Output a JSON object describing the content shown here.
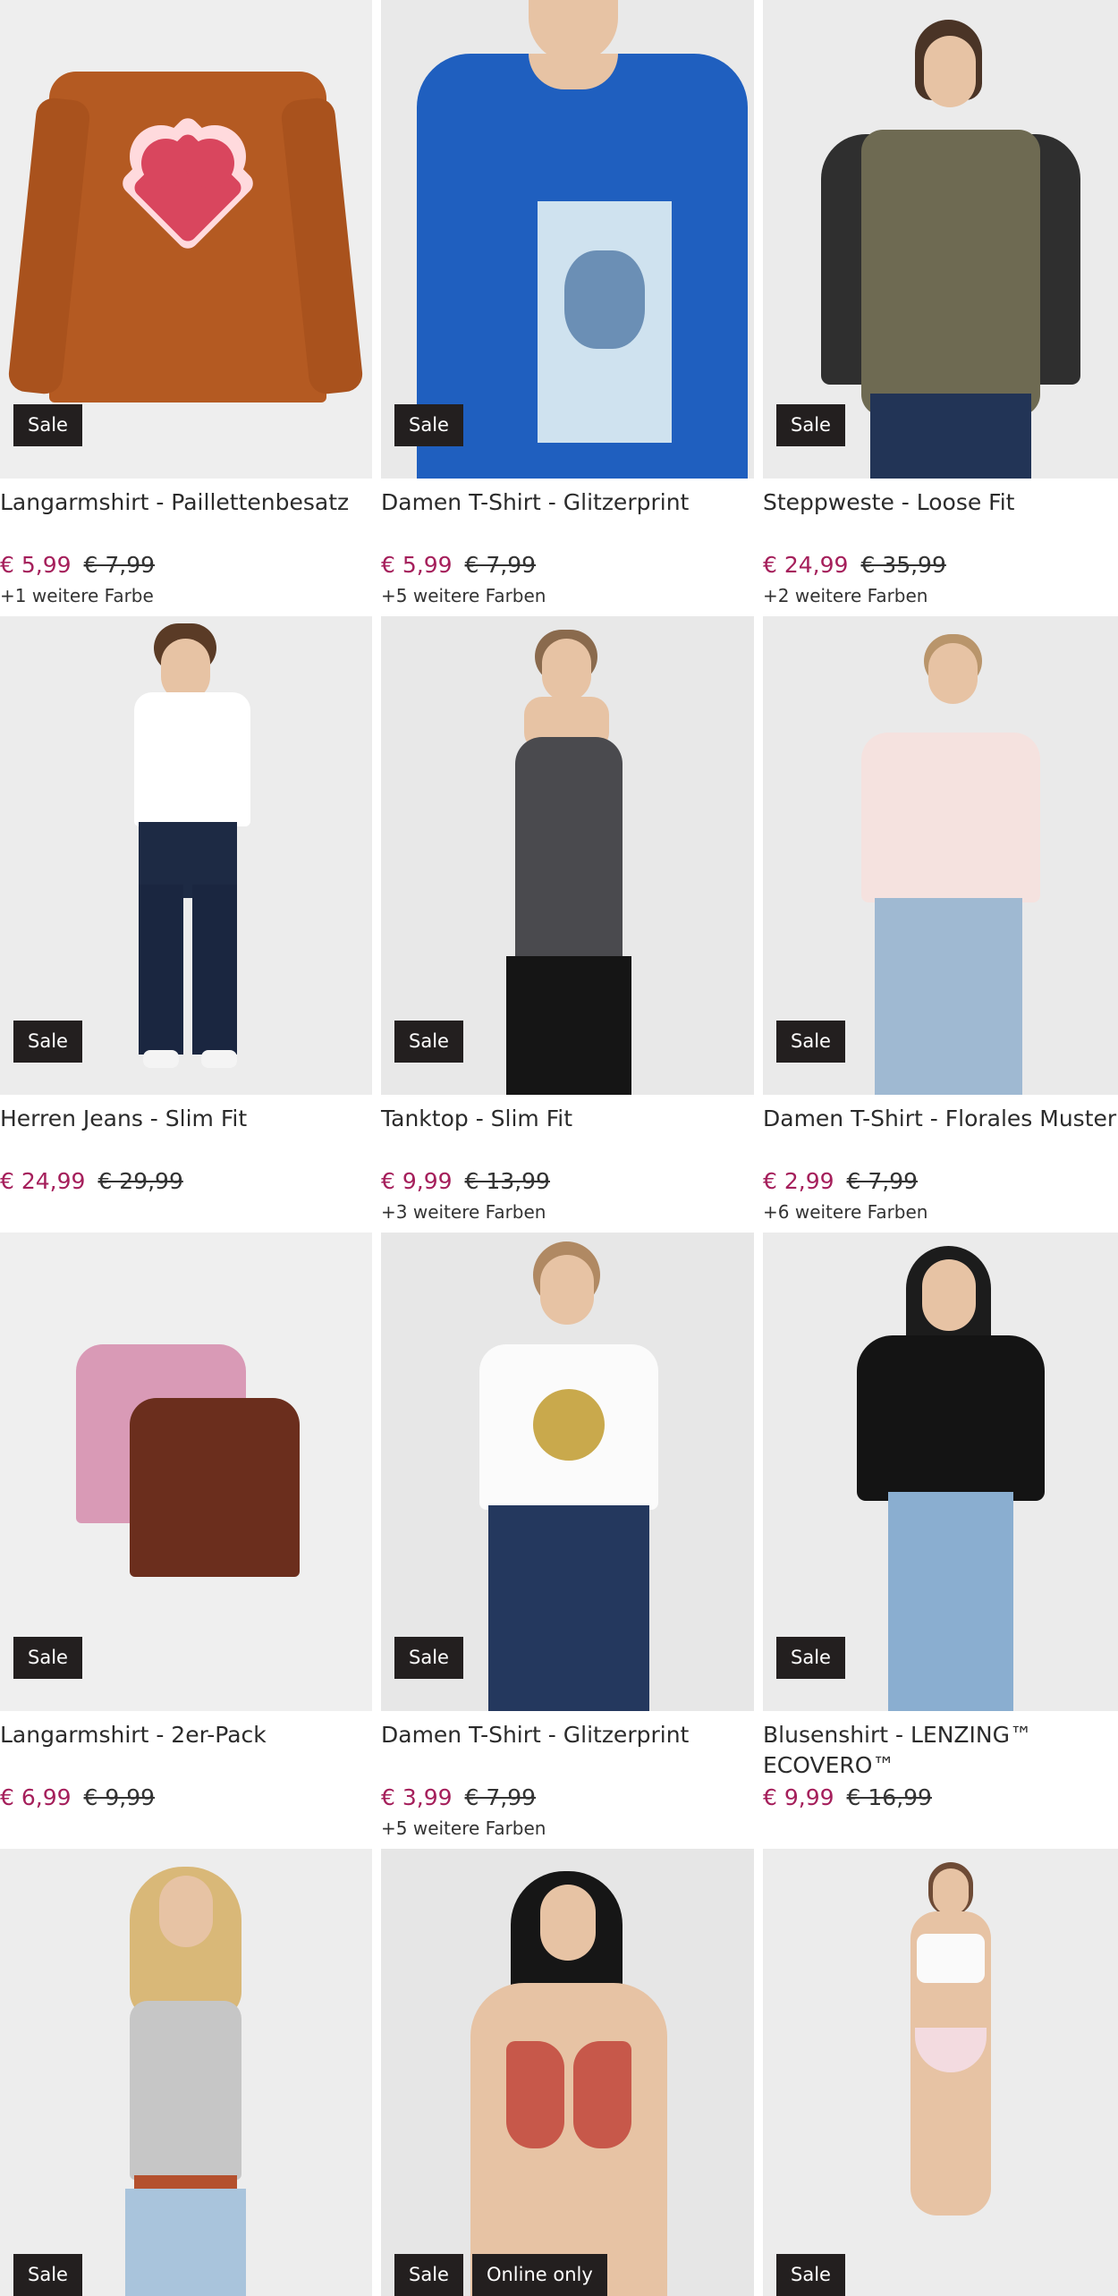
{
  "products": [
    {
      "title": "Langarmshirt - Paillettenbesatz",
      "price": "€ 5,99",
      "old_price": "€ 7,99",
      "colors": "+1 weitere Farbe",
      "badges": [
        "Sale"
      ],
      "image": "orange-longsleeve-heart"
    },
    {
      "title": "Damen T-Shirt - Glitzerprint",
      "price": "€ 5,99",
      "old_price": "€ 7,99",
      "colors": "+5 weitere Farben",
      "badges": [
        "Sale"
      ],
      "image": "blue-tshirt-print"
    },
    {
      "title": "Steppweste - Loose Fit",
      "price": "€ 24,99",
      "old_price": "€ 35,99",
      "colors": "+2 weitere Farben",
      "badges": [
        "Sale"
      ],
      "image": "olive-vest-man"
    },
    {
      "title": "Herren Jeans - Slim Fit",
      "price": "€ 24,99",
      "old_price": "€ 29,99",
      "colors": "",
      "badges": [
        "Sale"
      ],
      "image": "man-jeans-white-tee"
    },
    {
      "title": "Tanktop - Slim Fit",
      "price": "€ 9,99",
      "old_price": "€ 13,99",
      "colors": "+3 weitere Farben",
      "badges": [
        "Sale"
      ],
      "image": "grey-tanktop"
    },
    {
      "title": "Damen T-Shirt - Florales Muster",
      "price": "€ 2,99",
      "old_price": "€ 7,99",
      "colors": "+6 weitere Farben",
      "badges": [
        "Sale"
      ],
      "image": "pink-floral-tee"
    },
    {
      "title": "Langarmshirt - 2er-Pack",
      "price": "€ 6,99",
      "old_price": "€ 9,99",
      "colors": "",
      "badges": [
        "Sale"
      ],
      "image": "kids-longsleeve-pack"
    },
    {
      "title": "Damen T-Shirt - Glitzerprint",
      "price": "€ 3,99",
      "old_price": "€ 7,99",
      "colors": "+5 weitere Farben",
      "badges": [
        "Sale"
      ],
      "image": "white-tee-gold-print"
    },
    {
      "title": "Blusenshirt - LENZING™ ECOVERO™",
      "price": "€ 9,99",
      "old_price": "€ 16,99",
      "colors": "",
      "badges": [
        "Sale"
      ],
      "image": "black-blouse"
    },
    {
      "title": "",
      "price": "",
      "old_price": "",
      "colors": "",
      "badges": [
        "Sale"
      ],
      "image": "grey-top-woman"
    },
    {
      "title": "",
      "price": "",
      "old_price": "",
      "colors": "",
      "badges": [
        "Sale",
        "Online only"
      ],
      "image": "red-bikini"
    },
    {
      "title": "",
      "price": "",
      "old_price": "",
      "colors": "",
      "badges": [
        "Sale"
      ],
      "image": "white-lingerie"
    }
  ],
  "colors": {
    "sale_price": "#a51f5b",
    "badge_bg": "#231f1f",
    "image_bg": "#e6e6e6"
  }
}
